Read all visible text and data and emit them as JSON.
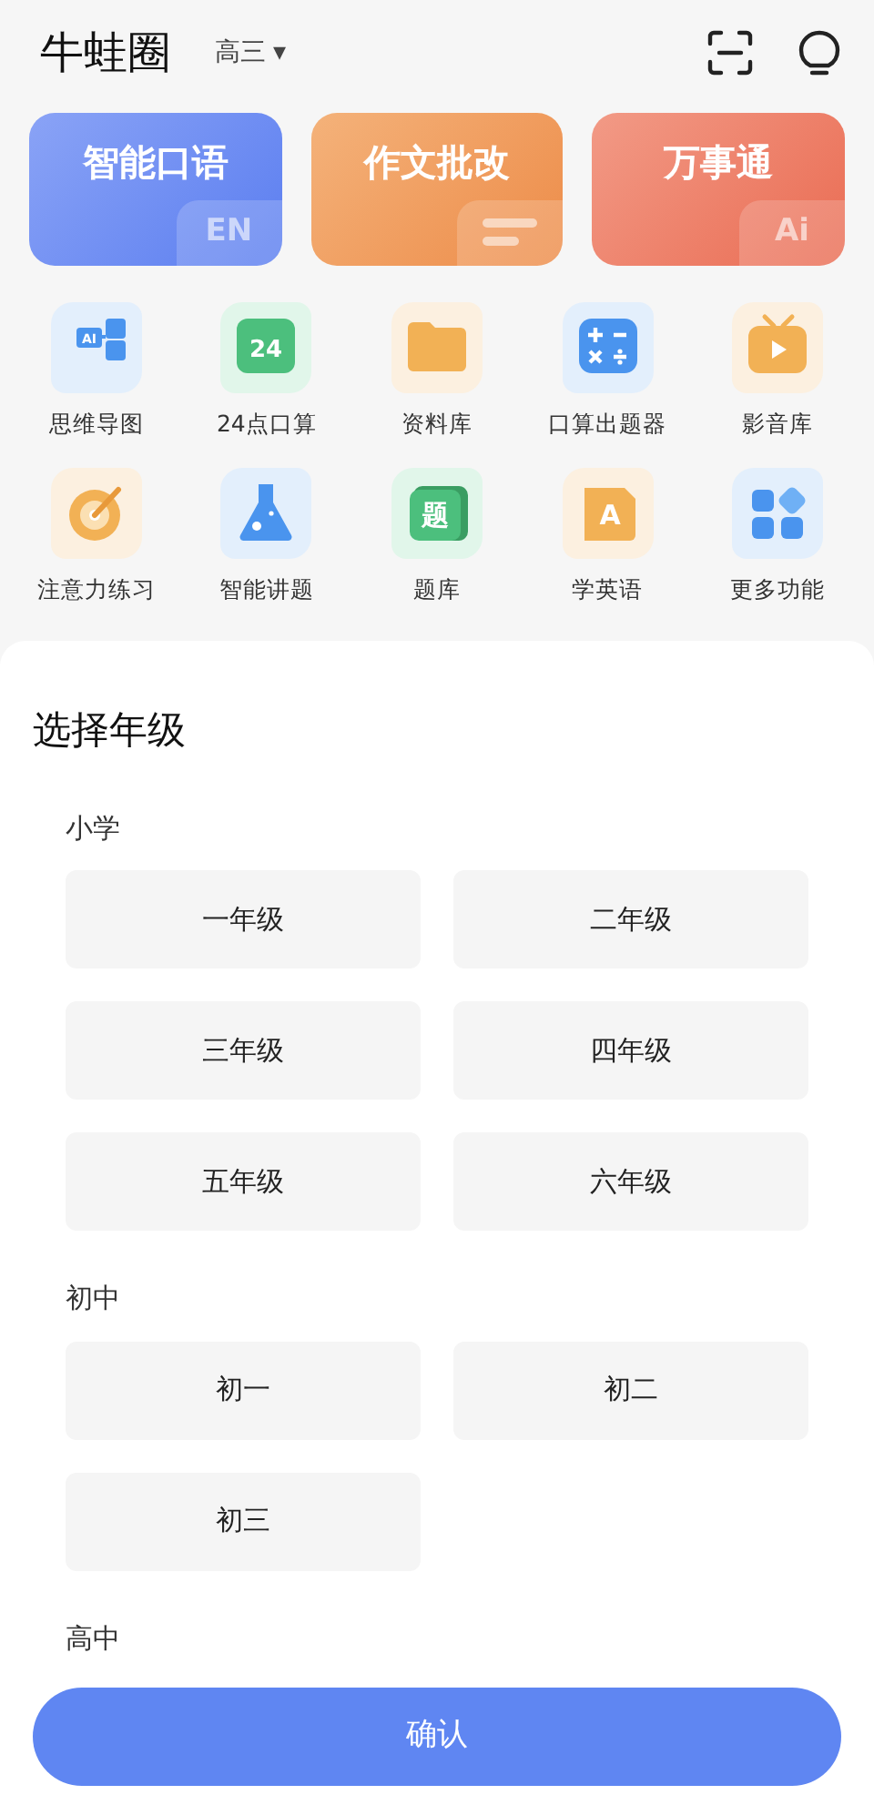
{
  "app_title": "牛蛙圈",
  "grade_switch": {
    "label": "高三",
    "caret": "▾"
  },
  "feature_cards": [
    {
      "kind": "blue",
      "label": "智能口语",
      "badge": "EN"
    },
    {
      "kind": "orange",
      "label": "作文批改"
    },
    {
      "kind": "red",
      "label": "万事通",
      "badge": "Ai"
    }
  ],
  "tools": [
    {
      "kind": "mindmap",
      "label": "思维导图",
      "glyph": "AI"
    },
    {
      "kind": "calendar",
      "label": "24点口算",
      "glyph": "24"
    },
    {
      "kind": "folder",
      "label": "资料库"
    },
    {
      "kind": "calculator",
      "label": "口算出题器"
    },
    {
      "kind": "tv",
      "label": "影音库"
    },
    {
      "kind": "target",
      "label": "注意力练习"
    },
    {
      "kind": "flask",
      "label": "智能讲题"
    },
    {
      "kind": "book",
      "label": "题库",
      "glyph": "题"
    },
    {
      "kind": "letter",
      "label": "学英语",
      "glyph": "A"
    },
    {
      "kind": "grid",
      "label": "更多功能"
    }
  ],
  "sheet": {
    "title": "选择年级",
    "sections": [
      {
        "label": "小学",
        "grades": [
          {
            "label": "一年级",
            "selected": false
          },
          {
            "label": "二年级",
            "selected": false
          },
          {
            "label": "三年级",
            "selected": false
          },
          {
            "label": "四年级",
            "selected": false
          },
          {
            "label": "五年级",
            "selected": false
          },
          {
            "label": "六年级",
            "selected": false
          }
        ]
      },
      {
        "label": "初中",
        "grades": [
          {
            "label": "初一",
            "selected": false
          },
          {
            "label": "初二",
            "selected": false
          },
          {
            "label": "初三",
            "selected": false
          }
        ]
      },
      {
        "label": "高中"
      }
    ],
    "confirm": "确认"
  }
}
